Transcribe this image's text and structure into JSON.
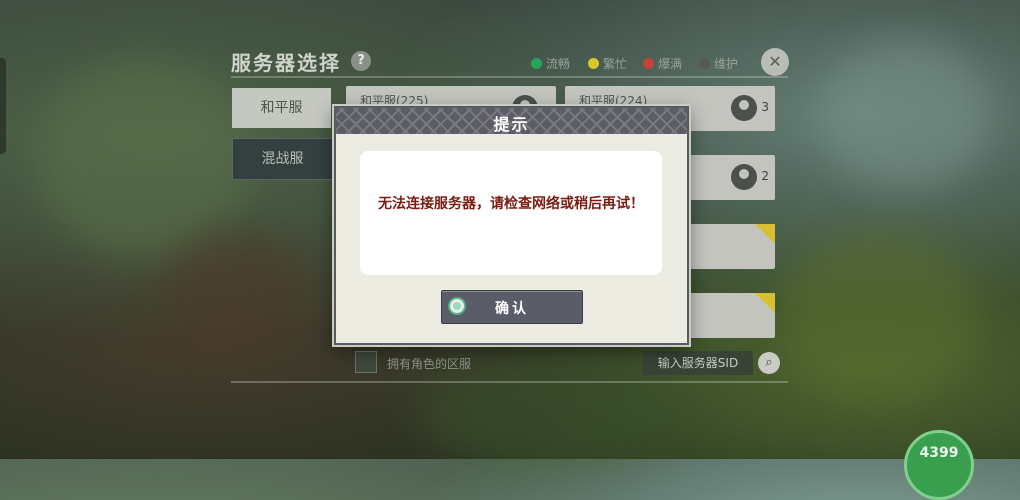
{
  "server_panel": {
    "title": "服务器选择",
    "help_icon": "?",
    "legend": [
      {
        "label": "流畅",
        "color": "#27a35a"
      },
      {
        "label": "繁忙",
        "color": "#d8c62a"
      },
      {
        "label": "爆满",
        "color": "#c8403a"
      },
      {
        "label": "维护",
        "color": "#555a55"
      }
    ],
    "tabs": [
      {
        "label": "和平服",
        "active": true
      },
      {
        "label": "混战服",
        "active": false
      }
    ],
    "servers": [
      {
        "name": "和平服(225)",
        "players": ""
      },
      {
        "name": "和平服(224)",
        "players": "3"
      },
      {
        "name": "",
        "players": "2"
      },
      {
        "name": "",
        "players": ""
      },
      {
        "name": "",
        "players": ""
      }
    ],
    "filter_checkbox_label": "拥有角色的区服",
    "sid_input_placeholder": "输入服务器SID"
  },
  "coin_badge": "4399",
  "dialog": {
    "title": "提示",
    "message": "无法连接服务器，请检查网络或稍后再试！",
    "confirm_label": "确认"
  },
  "colors": {
    "dialog_header": "#5b5c66",
    "message_text": "#7a1c12",
    "confirm_button": "#5a5c68"
  }
}
